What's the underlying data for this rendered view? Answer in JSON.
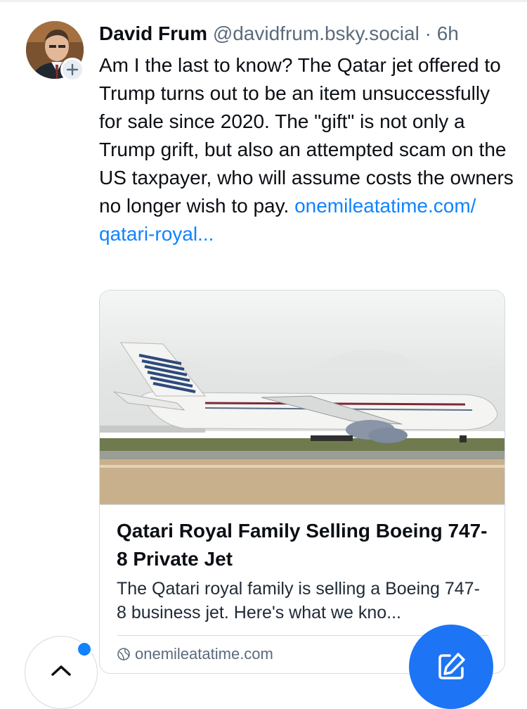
{
  "post": {
    "author_name": "David Frum",
    "author_handle": "@davidfrum.bsky.social",
    "separator": "·",
    "time": "6h",
    "text": "Am I the last to know? The Qatar jet offered to Trump turns out to be an item unsuccessfully for sale since 2020. The \"gift\" is not only a Trump grift, but also an attempted scam on the US taxpayer, who will assume costs the owners no longer wish to pay.",
    "link_display": "onemileatatime.com/ qatari-royal..."
  },
  "link_card": {
    "title": "Qatari Royal Family Selling Boeing 747-8 Private Jet",
    "description": "The Qatari royal family is selling a Boeing 747-8 business jet. Here's what we kno...",
    "domain": "onemileatatime.com"
  },
  "icons": {
    "follow": "plus-icon",
    "domain": "globe-icon",
    "scroll_top": "chevron-up-icon",
    "compose": "compose-icon"
  },
  "colors": {
    "link": "#1083fe",
    "fab": "#1d74f5",
    "secondary_text": "#5b6b7c",
    "border": "#d4dbe2"
  }
}
